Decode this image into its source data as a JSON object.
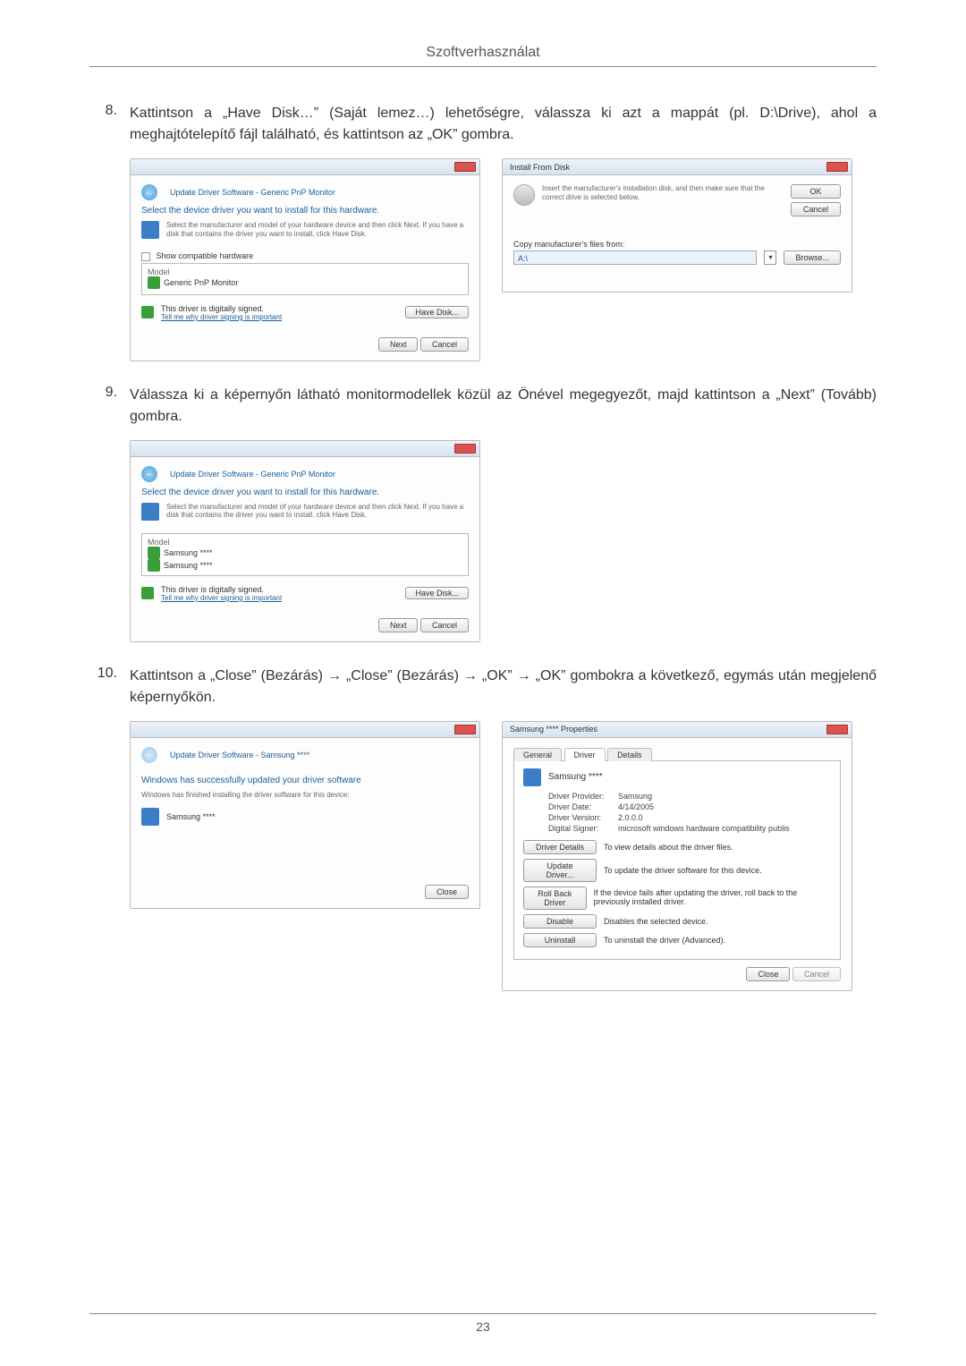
{
  "header": {
    "title": "Szoftverhasználat"
  },
  "steps": {
    "s8": {
      "num": "8.",
      "text": "Kattintson a „Have Disk…” (Saját lemez…) lehetőségre, válassza ki azt a mappát (pl. D:\\Drive), ahol a meghajtótelepítő fájl található, és kattintson az „OK” gombra."
    },
    "s9": {
      "num": "9.",
      "text": "Válassza ki a képernyőn látható monitormodellek közül az Önével megegyezőt, majd kattintson a „Next” (Tovább) gombra."
    },
    "s10": {
      "num": "10.",
      "text": "Kattintson a „Close” (Bezárás) → „Close” (Bezárás) → „OK” → „OK” gombokra a következő, egymás után megjelenő képernyőkön."
    }
  },
  "dlg_update1": {
    "crumb": "Update Driver Software - Generic PnP Monitor",
    "heading": "Select the device driver you want to install for this hardware.",
    "sub": "Select the manufacturer and model of your hardware device and then click Next. If you have a disk that contains the driver you want to install, click Have Disk.",
    "show_compat": "Show compatible hardware",
    "model_label": "Model",
    "model_item": "Generic PnP Monitor",
    "signed": "This driver is digitally signed.",
    "tell": "Tell me why driver signing is important",
    "have_disk": "Have Disk...",
    "next": "Next",
    "cancel": "Cancel"
  },
  "dlg_install": {
    "title": "Install From Disk",
    "msg": "Insert the manufacturer's installation disk, and then make sure that the correct drive is selected below.",
    "ok": "OK",
    "cancel": "Cancel",
    "copy": "Copy manufacturer's files from:",
    "path": "A:\\",
    "browse": "Browse..."
  },
  "dlg_update2": {
    "crumb": "Update Driver Software - Generic PnP Monitor",
    "heading": "Select the device driver you want to install for this hardware.",
    "sub": "Select the manufacturer and model of your hardware device and then click Next. If you have a disk that contains the driver you want to install, click Have Disk.",
    "model_label": "Model",
    "model1": "Samsung ****",
    "model2": "Samsung ****",
    "signed": "This driver is digitally signed.",
    "tell": "Tell me why driver signing is important",
    "have_disk": "Have Disk...",
    "next": "Next",
    "cancel": "Cancel"
  },
  "dlg_done": {
    "crumb": "Update Driver Software - Samsung ****",
    "heading": "Windows has successfully updated your driver software",
    "sub": "Windows has finished installing the driver software for this device:",
    "device": "Samsung ****",
    "close": "Close"
  },
  "dlg_props": {
    "title": "Samsung **** Properties",
    "tab_general": "General",
    "tab_driver": "Driver",
    "tab_details": "Details",
    "device": "Samsung ****",
    "provider_l": "Driver Provider:",
    "provider_v": "Samsung",
    "date_l": "Driver Date:",
    "date_v": "4/14/2005",
    "version_l": "Driver Version:",
    "version_v": "2.0.0.0",
    "signer_l": "Digital Signer:",
    "signer_v": "microsoft windows hardware compatibility publis",
    "btn_details": "Driver Details",
    "desc_details": "To view details about the driver files.",
    "btn_update": "Update Driver...",
    "desc_update": "To update the driver software for this device.",
    "btn_rollback": "Roll Back Driver",
    "desc_rollback": "If the device fails after updating the driver, roll back to the previously installed driver.",
    "btn_disable": "Disable",
    "desc_disable": "Disables the selected device.",
    "btn_uninstall": "Uninstall",
    "desc_uninstall": "To uninstall the driver (Advanced).",
    "close": "Close",
    "cancel": "Cancel"
  },
  "footer": {
    "page": "23"
  }
}
